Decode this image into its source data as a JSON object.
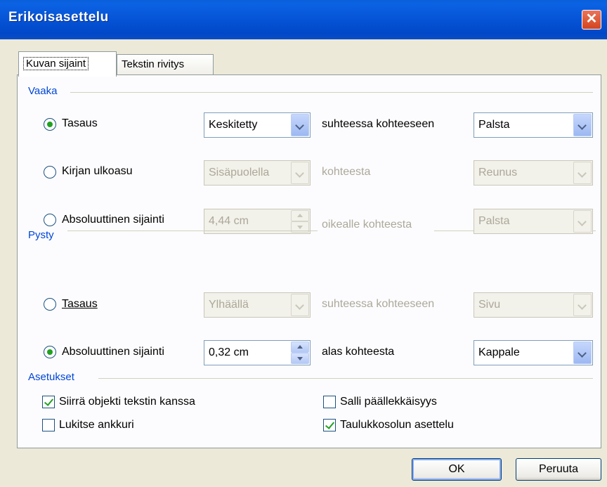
{
  "window": {
    "title": "Erikoisasettelu",
    "close_icon": "close-icon"
  },
  "tabs": [
    {
      "label": "Kuvan sijaint",
      "active": true
    },
    {
      "label": "Tekstin rivitys",
      "active": false
    }
  ],
  "horizontal": {
    "group_label": "Vaaka",
    "alignment": {
      "label": "Tasaus",
      "selected": true,
      "value": "Keskitetty",
      "relative_label": "suhteessa kohteeseen",
      "relative_value": "Palsta"
    },
    "book_layout": {
      "label": "Kirjan ulkoasu",
      "selected": false,
      "value": "Sisäpuolella",
      "relative_label": "kohteesta",
      "relative_value": "Reunus"
    },
    "absolute": {
      "label": "Absoluuttinen sijainti",
      "selected": false,
      "value": "4,44 cm",
      "relative_label": "oikealle kohteesta",
      "relative_value": "Palsta"
    }
  },
  "vertical": {
    "group_label": "Pysty",
    "alignment": {
      "label": "Tasaus",
      "selected": false,
      "value": "Ylhäällä",
      "relative_label": "suhteessa kohteeseen",
      "relative_value": "Sivu"
    },
    "absolute": {
      "label": "Absoluuttinen sijainti",
      "selected": true,
      "value": "0,32 cm",
      "relative_label": "alas kohteesta",
      "relative_value": "Kappale"
    }
  },
  "options": {
    "group_label": "Asetukset",
    "move_with_text": {
      "label": "Siirrä objekti tekstin kanssa",
      "checked": true
    },
    "lock_anchor": {
      "label": "Lukitse ankkuri",
      "checked": false
    },
    "allow_overlap": {
      "label": "Salli päällekkäisyys",
      "checked": false
    },
    "table_cell_layout": {
      "label": "Taulukkosolun asettelu",
      "checked": true
    }
  },
  "buttons": {
    "ok": "OK",
    "cancel": "Peruuta"
  }
}
